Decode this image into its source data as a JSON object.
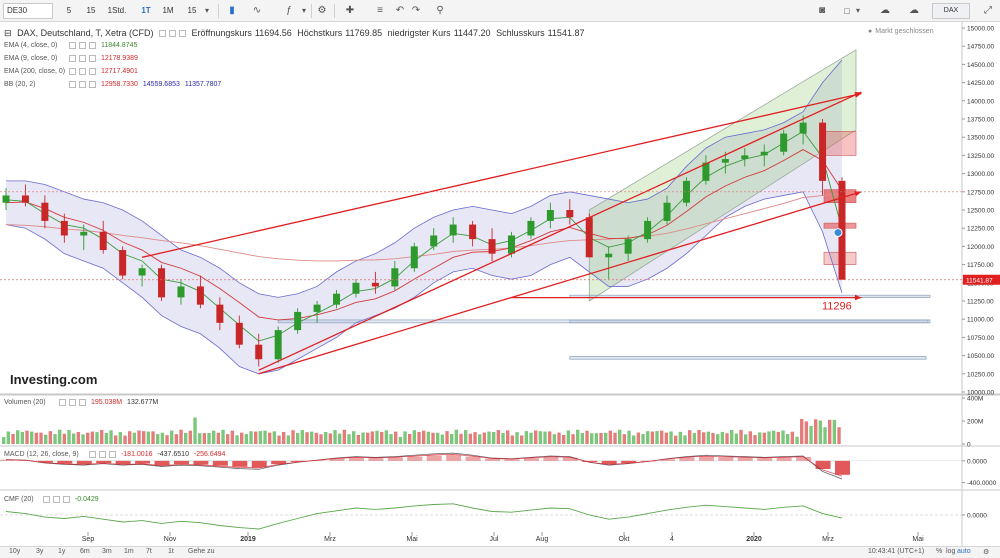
{
  "toolbar": {
    "symbol": "DE30",
    "intervals": [
      "5",
      "15",
      "1Std.",
      "1T",
      "1M",
      "15"
    ],
    "active_interval": "1T",
    "right_symbol": "DAX"
  },
  "main": {
    "title": "DAX, Deutschland, T, Xetra (CFD)",
    "ohlc": [
      {
        "label": "Eröffnungskurs",
        "value": "11694.56"
      },
      {
        "label": "Höchstkurs",
        "value": "11769.85"
      },
      {
        "label": "niedrigster Kurs",
        "value": "11447.20"
      },
      {
        "label": "Schlusskurs",
        "value": "11541.87"
      }
    ],
    "market_status": "Markt geschlossen",
    "indicators": [
      {
        "label": "EMA (4, close, 0)",
        "values": [
          "11844.8745"
        ],
        "colors": [
          "#3a8a2a"
        ]
      },
      {
        "label": "EMA (9, close, 0)",
        "values": [
          "12178.9389"
        ],
        "colors": [
          "#d12a2a"
        ]
      },
      {
        "label": "EMA (200, close, 0)",
        "values": [
          "12717.4901"
        ],
        "colors": [
          "#d12a2a"
        ]
      },
      {
        "label": "BB (20, 2)",
        "values": [
          "12958.7330",
          "14559.6853",
          "11357.7807"
        ],
        "colors": [
          "#d12a2a",
          "#2a2aa8",
          "#2a2aa8"
        ]
      }
    ],
    "price_tag": "11541.87",
    "support_label": "11296",
    "logo": "Investing.com"
  },
  "volume": {
    "label": "Volumen (20)",
    "values": [
      "195.038M",
      "132.677M"
    ]
  },
  "macd": {
    "label": "MACD (12, 26, close, 9)",
    "values": [
      "-181.0016",
      "-437.6510",
      "-256.6494"
    ]
  },
  "cmf": {
    "label": "CMF (20)",
    "values": [
      "-0.0429"
    ]
  },
  "bottombar": {
    "ranges": [
      "10y",
      "3y",
      "1y",
      "6m",
      "3m",
      "1m",
      "7t",
      "1t",
      "Gehe zu"
    ],
    "time": "10:43:41 (UTC+1)",
    "percent": "%",
    "log": "log",
    "auto": "auto"
  },
  "chart_data": {
    "type": "candlestick",
    "x_tick_labels": [
      "Sep",
      "Nov",
      "2019",
      "Mrz",
      "Mai",
      "Jul",
      "Aug",
      "Okt",
      "4",
      "2020",
      "Mrz",
      "Mai"
    ],
    "main": {
      "y_ticks": [
        "15000.00",
        "14750.00",
        "14500.00",
        "14250.00",
        "14000.00",
        "13750.00",
        "13500.00",
        "13250.00",
        "13000.00",
        "12750.00",
        "12500.00",
        "12250.00",
        "12000.00",
        "11750.00",
        "11500.00",
        "11250.00",
        "11000.00",
        "10750.00",
        "10500.00",
        "10250.00",
        "10000.00"
      ],
      "ylim": [
        10000,
        15000
      ],
      "candles": [
        [
          12600,
          12800,
          12500,
          12700
        ],
        [
          12700,
          12850,
          12550,
          12600
        ],
        [
          12600,
          12700,
          12250,
          12350
        ],
        [
          12350,
          12450,
          12050,
          12150
        ],
        [
          12150,
          12300,
          11950,
          12200
        ],
        [
          12200,
          12350,
          11900,
          11950
        ],
        [
          11950,
          12000,
          11550,
          11600
        ],
        [
          11600,
          11750,
          11450,
          11700
        ],
        [
          11700,
          11750,
          11250,
          11300
        ],
        [
          11300,
          11550,
          11200,
          11450
        ],
        [
          11450,
          11600,
          11150,
          11200
        ],
        [
          11200,
          11300,
          10850,
          10950
        ],
        [
          10950,
          11050,
          10600,
          10650
        ],
        [
          10650,
          10800,
          10350,
          10450
        ],
        [
          10450,
          10900,
          10400,
          10850
        ],
        [
          10850,
          11150,
          10800,
          11100
        ],
        [
          11100,
          11250,
          10950,
          11200
        ],
        [
          11200,
          11400,
          11150,
          11350
        ],
        [
          11350,
          11550,
          11300,
          11500
        ],
        [
          11500,
          11650,
          11350,
          11450
        ],
        [
          11450,
          11800,
          11400,
          11700
        ],
        [
          11700,
          12050,
          11650,
          12000
        ],
        [
          12000,
          12250,
          11950,
          12150
        ],
        [
          12150,
          12400,
          12050,
          12300
        ],
        [
          12300,
          12350,
          12000,
          12100
        ],
        [
          12100,
          12250,
          11800,
          11900
        ],
        [
          11900,
          12200,
          11850,
          12150
        ],
        [
          12150,
          12400,
          12100,
          12350
        ],
        [
          12350,
          12600,
          12250,
          12500
        ],
        [
          12500,
          12650,
          12300,
          12400
        ],
        [
          12400,
          12450,
          11850,
          11850
        ],
        [
          11850,
          12000,
          11550,
          11900
        ],
        [
          11900,
          12150,
          11800,
          12100
        ],
        [
          12100,
          12400,
          12050,
          12350
        ],
        [
          12350,
          12700,
          12300,
          12600
        ],
        [
          12600,
          12950,
          12550,
          12900
        ],
        [
          12900,
          13250,
          12850,
          13150
        ],
        [
          13150,
          13300,
          13000,
          13200
        ],
        [
          13200,
          13350,
          13100,
          13250
        ],
        [
          13250,
          13400,
          13100,
          13300
        ],
        [
          13300,
          13600,
          13250,
          13550
        ],
        [
          13550,
          13800,
          13400,
          13700
        ],
        [
          13700,
          13750,
          12700,
          12900
        ],
        [
          12900,
          12950,
          11700,
          11542
        ]
      ],
      "ema_4": [
        12640,
        12620,
        12450,
        12300,
        12250,
        12100,
        11900,
        11800,
        11550,
        11500,
        11380,
        11150,
        10920,
        10700,
        10780,
        10950,
        11080,
        11220,
        11380,
        11420,
        11560,
        11800,
        12000,
        12180,
        12140,
        12020,
        12080,
        12220,
        12380,
        12400,
        12120,
        11990,
        12050,
        12200,
        12420,
        12700,
        12950,
        13100,
        13200,
        13260,
        13420,
        13580,
        13220,
        12240
      ],
      "ema_9": [
        12600,
        12610,
        12520,
        12400,
        12330,
        12220,
        12060,
        11950,
        11780,
        11700,
        11590,
        11420,
        11230,
        11030,
        10990,
        11010,
        11060,
        11130,
        11230,
        11280,
        11390,
        11550,
        11700,
        11850,
        11920,
        11930,
        11980,
        12080,
        12200,
        12260,
        12180,
        12110,
        12110,
        12160,
        12290,
        12480,
        12680,
        12830,
        12950,
        13040,
        13180,
        13330,
        13180,
        12770
      ],
      "ema_200": [
        12300,
        12290,
        12270,
        12240,
        12220,
        12190,
        12150,
        12120,
        12080,
        12050,
        12010,
        11960,
        11910,
        11860,
        11830,
        11810,
        11800,
        11800,
        11810,
        11815,
        11830,
        11860,
        11890,
        11930,
        11950,
        11960,
        11980,
        12010,
        12050,
        12080,
        12090,
        12100,
        12120,
        12140,
        12180,
        12240,
        12310,
        12380,
        12450,
        12520,
        12590,
        12670,
        12700,
        12717
      ],
      "bb_upper": [
        12900,
        12900,
        12850,
        12750,
        12650,
        12600,
        12500,
        12350,
        12150,
        11950,
        11850,
        11700,
        11500,
        11350,
        11300,
        11350,
        11450,
        11650,
        11800,
        11900,
        12050,
        12250,
        12400,
        12500,
        12550,
        12500,
        12450,
        12550,
        12700,
        12750,
        12700,
        12650,
        12600,
        12650,
        12800,
        13100,
        13350,
        13500,
        13550,
        13600,
        13700,
        13850,
        14250,
        14560
      ],
      "bb_lower": [
        12300,
        12250,
        12100,
        11900,
        11800,
        11700,
        11500,
        11300,
        11050,
        10900,
        10800,
        10600,
        10350,
        10250,
        10300,
        10450,
        10600,
        10750,
        10950,
        11050,
        11150,
        11300,
        11500,
        11650,
        11700,
        11600,
        11550,
        11600,
        11750,
        11850,
        11650,
        11450,
        11450,
        11550,
        11700,
        11900,
        12150,
        12400,
        12550,
        12650,
        12700,
        12750,
        12200,
        11358
      ],
      "trend_lines": [
        {
          "from_index": 13,
          "from_value": 10300,
          "to_index": 44,
          "to_value": 14120
        },
        {
          "from_index": 7,
          "from_value": 11850,
          "to_index": 44,
          "to_value": 14100
        },
        {
          "from_index": 13,
          "from_value": 10250,
          "to_index": 44,
          "to_value": 12750
        },
        {
          "from_index": 26,
          "from_value": 11296,
          "to_index": 44,
          "to_value": 11296
        }
      ],
      "support_level": 11296
    },
    "volume": {
      "y_ticks": [
        "400M",
        "200M",
        "0"
      ],
      "ylim": [
        0,
        400
      ]
    },
    "macd": {
      "y_ticks": [
        "0.0000",
        "-400.0000"
      ],
      "ylim": [
        -500,
        200
      ],
      "histogram": [
        20,
        10,
        -30,
        -50,
        -60,
        -40,
        -60,
        -50,
        -80,
        -60,
        -70,
        -90,
        -110,
        -120,
        -60,
        -20,
        10,
        40,
        60,
        50,
        60,
        80,
        100,
        110,
        80,
        40,
        30,
        50,
        70,
        60,
        -20,
        -60,
        -40,
        -10,
        30,
        60,
        80,
        70,
        60,
        50,
        60,
        70,
        -150,
        -257
      ]
    },
    "cmf": {
      "y_ticks": [
        "0.0000"
      ],
      "ylim": [
        -0.3,
        0.3
      ],
      "values": [
        0.05,
        0.02,
        -0.03,
        -0.05,
        -0.02,
        -0.06,
        -0.1,
        -0.08,
        -0.12,
        -0.09,
        -0.11,
        -0.15,
        -0.18,
        -0.2,
        -0.12,
        -0.05,
        0.02,
        0.06,
        0.1,
        0.08,
        0.1,
        0.13,
        0.15,
        0.16,
        0.1,
        0.05,
        0.04,
        0.07,
        0.1,
        0.09,
        0.0,
        -0.06,
        -0.03,
        0.02,
        0.07,
        0.11,
        0.14,
        0.12,
        0.1,
        0.08,
        0.11,
        0.13,
        0.02,
        -0.043
      ]
    }
  }
}
